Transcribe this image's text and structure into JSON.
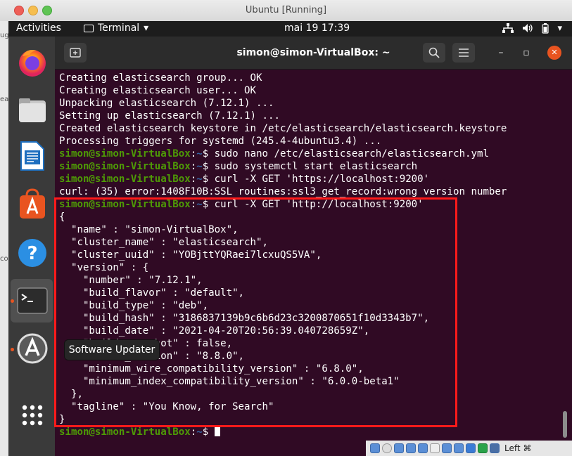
{
  "mac_window": {
    "title": "Ubuntu [Running]"
  },
  "side_fragments": [
    "ugi",
    "ea",
    "co"
  ],
  "ubuntu_panel": {
    "activities": "Activities",
    "app_menu": "Terminal",
    "clock": "mai 19  17:39"
  },
  "dock": {
    "tooltip": "Software Updater",
    "items": [
      "firefox-icon",
      "files-icon",
      "libreoffice-writer-icon",
      "ubuntu-software-icon",
      "help-icon",
      "terminal-icon",
      "software-updater-icon",
      "show-applications-icon"
    ]
  },
  "terminal": {
    "title": "simon@simon-VirtualBox: ~",
    "prompt_user": "simon@simon-VirtualBox",
    "prompt_path": "~",
    "prompt_sep": ":",
    "prompt_end": "$ ",
    "lines": [
      {
        "type": "out",
        "text": "Creating elasticsearch group... OK"
      },
      {
        "type": "out",
        "text": "Creating elasticsearch user... OK"
      },
      {
        "type": "out",
        "text": "Unpacking elasticsearch (7.12.1) ..."
      },
      {
        "type": "out",
        "text": "Setting up elasticsearch (7.12.1) ..."
      },
      {
        "type": "out",
        "text": "Created elasticsearch keystore in /etc/elasticsearch/elasticsearch.keystore"
      },
      {
        "type": "out",
        "text": "Processing triggers for systemd (245.4-4ubuntu3.4) ..."
      },
      {
        "type": "cmd",
        "text": "sudo nano /etc/elasticsearch/elasticsearch.yml"
      },
      {
        "type": "cmd",
        "text": "sudo systemctl start elasticsearch"
      },
      {
        "type": "cmd",
        "text": "curl -X GET 'https://localhost:9200'"
      },
      {
        "type": "out",
        "text": "curl: (35) error:1408F10B:SSL routines:ssl3_get_record:wrong version number"
      },
      {
        "type": "cmd",
        "text": "curl -X GET 'http://localhost:9200'"
      },
      {
        "type": "out",
        "text": "{"
      },
      {
        "type": "out",
        "text": "  \"name\" : \"simon-VirtualBox\","
      },
      {
        "type": "out",
        "text": "  \"cluster_name\" : \"elasticsearch\","
      },
      {
        "type": "out",
        "text": "  \"cluster_uuid\" : \"YOBjttYQRaei7lcxuQS5VA\","
      },
      {
        "type": "out",
        "text": "  \"version\" : {"
      },
      {
        "type": "out",
        "text": "    \"number\" : \"7.12.1\","
      },
      {
        "type": "out",
        "text": "    \"build_flavor\" : \"default\","
      },
      {
        "type": "out",
        "text": "    \"build_type\" : \"deb\","
      },
      {
        "type": "out",
        "text": "    \"build_hash\" : \"3186837139b9c6b6d23c3200870651f10d3343b7\","
      },
      {
        "type": "out",
        "text": "    \"build_date\" : \"2021-04-20T20:56:39.040728659Z\","
      },
      {
        "type": "out",
        "text": "    \"build_snapshot\" : false,"
      },
      {
        "type": "out",
        "text": "    \"lucene_version\" : \"8.8.0\","
      },
      {
        "type": "out",
        "text": "    \"minimum_wire_compatibility_version\" : \"6.8.0\","
      },
      {
        "type": "out",
        "text": "    \"minimum_index_compatibility_version\" : \"6.0.0-beta1\""
      },
      {
        "type": "out",
        "text": "  },"
      },
      {
        "type": "out",
        "text": "  \"tagline\" : \"You Know, for Search\""
      },
      {
        "type": "out",
        "text": "}"
      },
      {
        "type": "cmd_cursor",
        "text": ""
      }
    ]
  },
  "vbox_status": {
    "host_key": "Left ⌘"
  },
  "colors": {
    "terminal_bg": "#300a24",
    "prompt_green": "#4e9a06",
    "prompt_blue": "#3465a4",
    "highlight_red": "#ff1a1a",
    "ubuntu_orange": "#e95420"
  }
}
